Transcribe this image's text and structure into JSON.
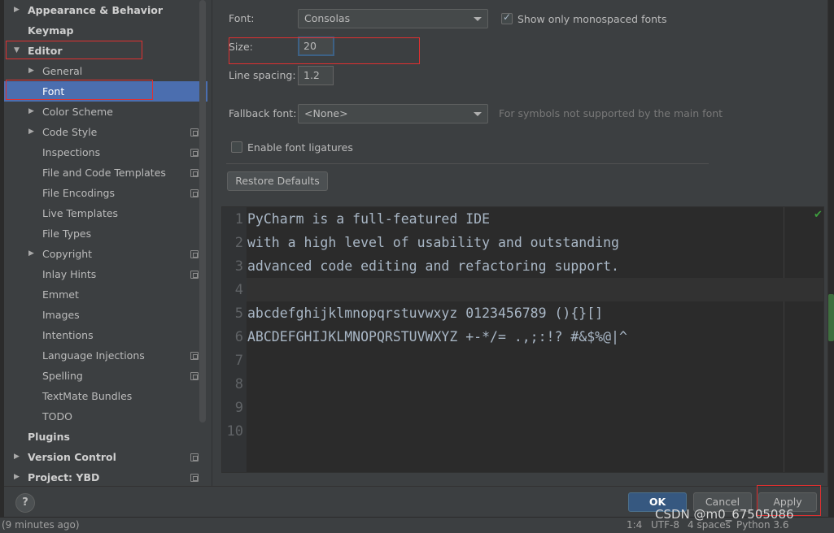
{
  "sidebar": {
    "items": [
      {
        "label": "Appearance & Behavior",
        "bold": true,
        "arrow": "▶",
        "level": 0
      },
      {
        "label": "Keymap",
        "bold": true,
        "arrow": "",
        "level": 0
      },
      {
        "label": "Editor",
        "bold": true,
        "arrow": "▼",
        "level": 0
      },
      {
        "label": "General",
        "bold": false,
        "arrow": "▶",
        "level": 1
      },
      {
        "label": "Font",
        "bold": false,
        "arrow": "",
        "level": 1,
        "selected": true
      },
      {
        "label": "Color Scheme",
        "bold": false,
        "arrow": "▶",
        "level": 1
      },
      {
        "label": "Code Style",
        "bold": false,
        "arrow": "▶",
        "level": 1,
        "copy": true
      },
      {
        "label": "Inspections",
        "bold": false,
        "arrow": "",
        "level": 1,
        "copy": true
      },
      {
        "label": "File and Code Templates",
        "bold": false,
        "arrow": "",
        "level": 1,
        "copy": true
      },
      {
        "label": "File Encodings",
        "bold": false,
        "arrow": "",
        "level": 1,
        "copy": true
      },
      {
        "label": "Live Templates",
        "bold": false,
        "arrow": "",
        "level": 1
      },
      {
        "label": "File Types",
        "bold": false,
        "arrow": "",
        "level": 1
      },
      {
        "label": "Copyright",
        "bold": false,
        "arrow": "▶",
        "level": 1,
        "copy": true
      },
      {
        "label": "Inlay Hints",
        "bold": false,
        "arrow": "",
        "level": 1,
        "copy": true
      },
      {
        "label": "Emmet",
        "bold": false,
        "arrow": "",
        "level": 1
      },
      {
        "label": "Images",
        "bold": false,
        "arrow": "",
        "level": 1
      },
      {
        "label": "Intentions",
        "bold": false,
        "arrow": "",
        "level": 1
      },
      {
        "label": "Language Injections",
        "bold": false,
        "arrow": "",
        "level": 1,
        "copy": true
      },
      {
        "label": "Spelling",
        "bold": false,
        "arrow": "",
        "level": 1,
        "copy": true
      },
      {
        "label": "TextMate Bundles",
        "bold": false,
        "arrow": "",
        "level": 1
      },
      {
        "label": "TODO",
        "bold": false,
        "arrow": "",
        "level": 1
      },
      {
        "label": "Plugins",
        "bold": true,
        "arrow": "",
        "level": 0
      },
      {
        "label": "Version Control",
        "bold": true,
        "arrow": "▶",
        "level": 0,
        "copy": true
      },
      {
        "label": "Project: YBD",
        "bold": true,
        "arrow": "▶",
        "level": 0,
        "copy": true
      }
    ]
  },
  "font_settings": {
    "font_label": "Font:",
    "font_value": "Consolas",
    "show_mono_label": "Show only monospaced fonts",
    "show_mono_checked": true,
    "size_label": "Size:",
    "size_value": "20",
    "line_spacing_label": "Line spacing:",
    "line_spacing_value": "1.2",
    "fallback_label": "Fallback font:",
    "fallback_value": "<None>",
    "fallback_hint": "For symbols not supported by the main font",
    "ligatures_label": "Enable font ligatures",
    "ligatures_checked": false,
    "restore_label": "Restore Defaults"
  },
  "preview": {
    "lines": [
      "PyCharm is a full-featured IDE",
      "with a high level of usability and outstanding",
      "advanced code editing and refactoring support.",
      "",
      "abcdefghijklmnopqrstuvwxyz 0123456789 (){}[]",
      "ABCDEFGHIJKLMNOPQRSTUVWXYZ +-*/= .,;:!? #&$%@|^",
      "",
      "",
      "",
      ""
    ],
    "line_numbers": [
      "1",
      "2",
      "3",
      "4",
      "5",
      "6",
      "7",
      "8",
      "9",
      "10"
    ],
    "caret_line": 4
  },
  "dialog_buttons": {
    "help": "?",
    "ok": "OK",
    "cancel": "Cancel",
    "apply": "Apply"
  },
  "statusbar": {
    "left": "(9 minutes ago)",
    "position": "1:4",
    "encoding": "UTF-8",
    "indent": "4 spaces",
    "interpreter": "Python 3.6"
  },
  "watermark": "CSDN @m0_67505086",
  "colors": {
    "selection": "#4b6eaf",
    "highlight_box": "#e03030",
    "ok_button": "#365880"
  }
}
